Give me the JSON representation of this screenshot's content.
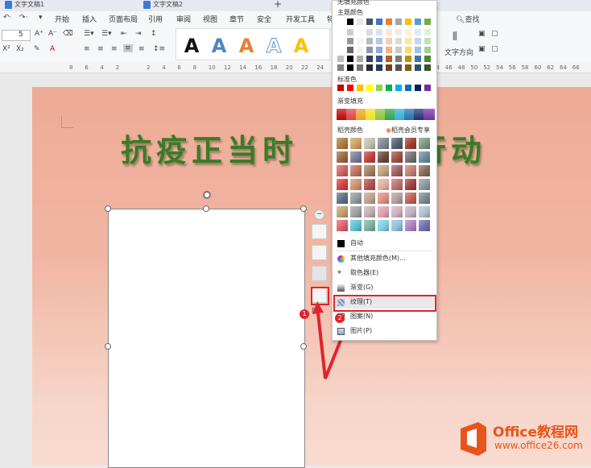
{
  "tabs": [
    {
      "label": "文字文稿1"
    },
    {
      "label": "文字文稿2"
    }
  ],
  "new_tab": "+",
  "ribbon_tabs": [
    "开始",
    "插入",
    "页面布局",
    "引用",
    "审阅",
    "视图",
    "章节",
    "安全",
    "开发工具",
    "特"
  ],
  "search_label": "查找",
  "font_size": "5",
  "text_direction_label": "文字方向",
  "art_letters": [
    "A",
    "A",
    "A",
    "A",
    "A"
  ],
  "ruler_ticks": [
    "8",
    "6",
    "4",
    "2",
    "",
    "2",
    "4",
    "6",
    "8",
    "10",
    "12",
    "14",
    "16",
    "18",
    "20",
    "22",
    "24",
    "26",
    "44",
    "46",
    "48",
    "50",
    "52",
    "54",
    "56",
    "58",
    "60",
    "62",
    "64",
    "66"
  ],
  "document": {
    "title_left": "抗疫正当时",
    "title_right": "在行动"
  },
  "menu": {
    "top_item": "无填充颜色",
    "theme_colors_label": "主题颜色",
    "standard_colors_label": "标准色",
    "gradient_fill_label": "渐变填充",
    "docer_colors_label": "稻壳颜色",
    "docer_member_label": "稻壳会员专享",
    "auto_label": "自动",
    "more_fill_label": "其他填充颜色(M)...",
    "eyedropper_label": "取色器(E)",
    "gradient_label": "渐变(G)",
    "texture_label": "纹理(T)",
    "pattern_label": "图案(N)",
    "picture_label": "图片(P)"
  },
  "colors": {
    "theme_row": [
      "#ffffff",
      "#000000",
      "#e7e6e6",
      "#44546a",
      "#4472c4",
      "#ed7d31",
      "#a5a5a5",
      "#ffc000",
      "#5b9bd5",
      "#70ad47"
    ],
    "standard": [
      "#c00000",
      "#ff0000",
      "#ffc000",
      "#ffff00",
      "#92d050",
      "#00b050",
      "#00b0f0",
      "#0070c0",
      "#002060",
      "#7030a0"
    ],
    "gradient": [
      "#c00000",
      "#e04040",
      "#f0a020",
      "#f0e020",
      "#90c040",
      "#30a050",
      "#30b0d0",
      "#2070b0",
      "#203070",
      "#7030a0"
    ],
    "accent": "#e2232a"
  },
  "badges": [
    "1",
    "2"
  ],
  "watermark": {
    "brand": "Office教程网",
    "url": "www.office26.com"
  }
}
